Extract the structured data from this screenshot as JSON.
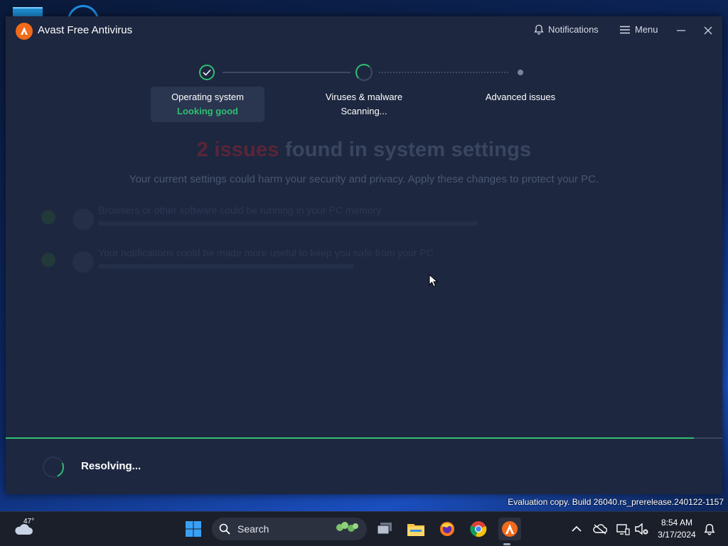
{
  "window": {
    "title": "Avast Free Antivirus",
    "notifications_label": "Notifications",
    "menu_label": "Menu"
  },
  "steps": [
    {
      "title": "Operating system",
      "status": "Looking good",
      "status_color": "#2fbf71"
    },
    {
      "title": "Viruses & malware",
      "status": "Scanning..."
    },
    {
      "title": "Advanced issues",
      "status": ""
    }
  ],
  "result": {
    "count_text": "2 issues",
    "headline_rest": "found in system settings",
    "description": "Your current settings could harm your security and privacy. Apply these changes to protect your PC.",
    "issues": [
      {
        "title": "Browsers or other software could be running in your PC memory"
      },
      {
        "title": "Your notifications could be made more useful to keep you safe from your PC"
      }
    ]
  },
  "footer": {
    "status_text": "Resolving...",
    "progress_fraction": 0.96
  },
  "watermark": "Evaluation copy. Build 26040.rs_prerelease.240122-1157",
  "taskbar": {
    "weather_temp": "47°",
    "search_label": "Search",
    "clock_time": "8:54 AM",
    "clock_date": "3/17/2024"
  },
  "colors": {
    "accent_green": "#2fbf71",
    "avast_orange": "#f26a1b",
    "window_bg": "#1d2740"
  }
}
